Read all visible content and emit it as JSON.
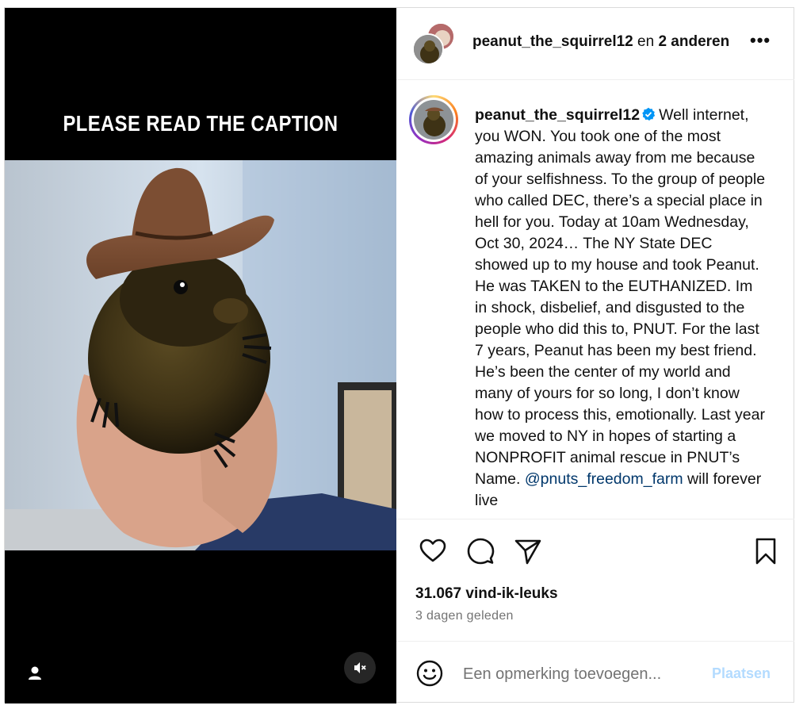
{
  "media": {
    "overlay_text": "PLEASE READ THE CAPTION",
    "user_tag_icon": "user-icon",
    "mute_icon": "speaker-muted-icon"
  },
  "header": {
    "username": "peanut_the_squirrel12",
    "connector": " en ",
    "others": "2 anderen",
    "more_icon": "more-horizontal-icon",
    "more_label": "•••"
  },
  "caption": {
    "username": "peanut_the_squirrel12",
    "verified_icon": "verified-badge-icon",
    "text": "Well internet, you WON. You took one of the most amazing animals away from me because of your selfishness. To the group of people who called DEC, there’s a special place in hell for you. Today at 10am Wednesday, Oct 30, 2024… The NY State DEC showed up to my house and took Peanut. He was TAKEN to the EUTHANIZED. Im in shock, disbelief, and disgusted to the people who did this to, PNUT. For the last 7 years, Peanut has been my best friend. He’s been the center of my world and many of yours for so long, I don’t know how to process this, emotionally. Last year we moved to NY in hopes of starting a NONPROFIT animal rescue in PNUT’s Name.",
    "mention": "@pnuts_freedom_farm",
    "tail": " will forever live"
  },
  "actions": {
    "like_icon": "heart-icon",
    "comment_icon": "comment-icon",
    "share_icon": "send-icon",
    "save_icon": "bookmark-icon"
  },
  "likes": "31.067 vind-ik-leuks",
  "time": "3 dagen geleden",
  "comment": {
    "emoji_icon": "emoji-icon",
    "placeholder": "Een opmerking toevoegen...",
    "post_label": "Plaatsen"
  },
  "colors": {
    "link": "#00376b",
    "post_button_disabled": "#b3dbff",
    "verified": "#0095f6",
    "muted_text": "#737373"
  }
}
